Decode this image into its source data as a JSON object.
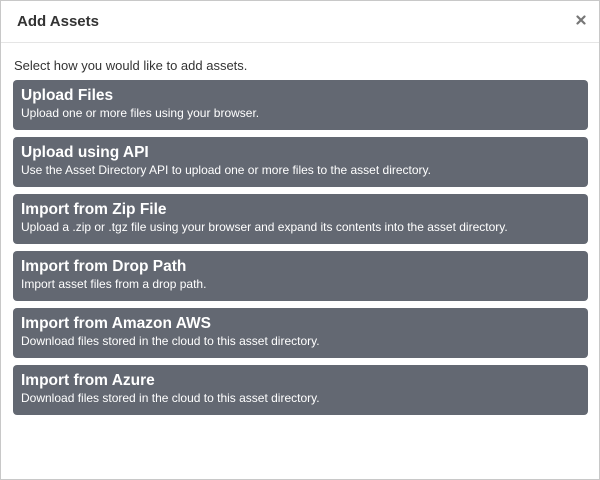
{
  "dialog": {
    "title": "Add Assets",
    "close_icon": "close-icon",
    "instructions": "Select how you would like to add assets."
  },
  "options": [
    {
      "title": "Upload Files",
      "description": "Upload one or more files using your browser."
    },
    {
      "title": "Upload using API",
      "description": "Use the Asset Directory API to upload one or more files to the asset directory."
    },
    {
      "title": "Import from Zip File",
      "description": "Upload a .zip or .tgz file using your browser and expand its contents into the asset directory."
    },
    {
      "title": "Import from Drop Path",
      "description": "Import asset files from a drop path."
    },
    {
      "title": "Import from Amazon AWS",
      "description": "Download files stored in the cloud to this asset directory."
    },
    {
      "title": "Import from Azure",
      "description": "Download files stored in the cloud to this asset directory."
    }
  ],
  "colors": {
    "option_background": "#636872",
    "option_text": "#ffffff",
    "title_text": "#333333"
  }
}
